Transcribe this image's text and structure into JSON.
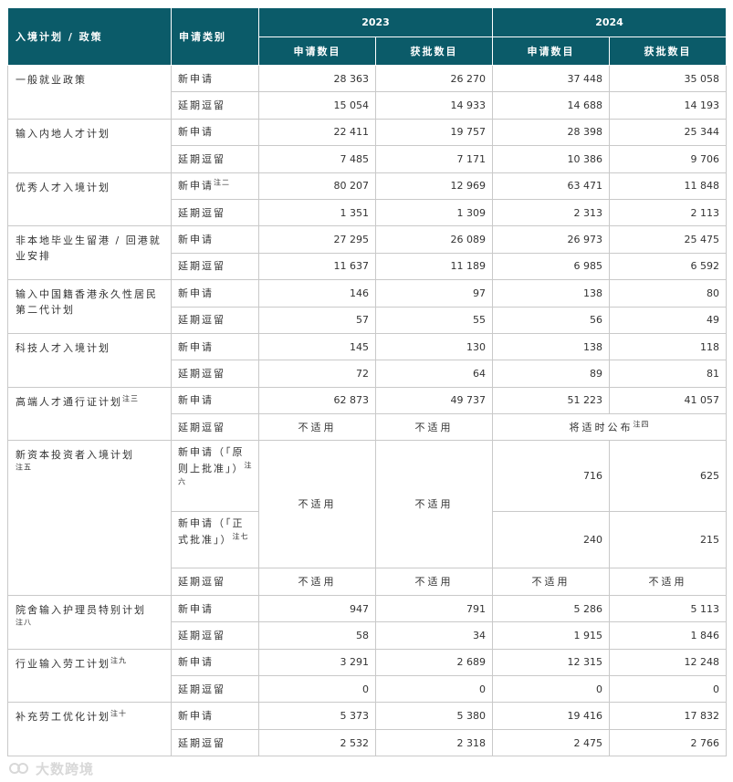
{
  "header": {
    "programme": "入境计划 / 政策",
    "category": "申请类别",
    "year1": "2023",
    "year2": "2024",
    "applications": "申请数目",
    "approved": "获批数目"
  },
  "labels": {
    "new": "新申请",
    "extension": "延期逗留",
    "na": "不适用"
  },
  "rows": {
    "gep": {
      "name": "一般就业政策",
      "new": [
        "28 363",
        "26 270",
        "37 448",
        "35 058"
      ],
      "ext": [
        "15 054",
        "14 933",
        "14 688",
        "14 193"
      ]
    },
    "asmtp": {
      "name": "输入内地人才计划",
      "new": [
        "22 411",
        "19 757",
        "28 398",
        "25 344"
      ],
      "ext": [
        "7 485",
        "7 171",
        "10 386",
        "9 706"
      ]
    },
    "qmas": {
      "name": "优秀人才入境计划",
      "note_new": "注二",
      "new": [
        "80 207",
        "12 969",
        "63 471",
        "11 848"
      ],
      "ext": [
        "1 351",
        "1 309",
        "2 313",
        "2 113"
      ]
    },
    "irnm": {
      "name": "非本地毕业生留港 / 回港就业安排",
      "new": [
        "27 295",
        "26 089",
        "26 973",
        "25 475"
      ],
      "ext": [
        "11 637",
        "11 189",
        "6 985",
        "6 592"
      ]
    },
    "second": {
      "name": "输入中国籍香港永久性居民第二代计划",
      "new": [
        "146",
        "97",
        "138",
        "80"
      ],
      "ext": [
        "57",
        "55",
        "56",
        "49"
      ]
    },
    "techtas": {
      "name": "科技人才入境计划",
      "new": [
        "145",
        "130",
        "138",
        "118"
      ],
      "ext": [
        "72",
        "64",
        "89",
        "81"
      ]
    },
    "ttps": {
      "name": "高端人才通行证计划",
      "note": "注三",
      "new": [
        "62 873",
        "49 737",
        "51 223",
        "41 057"
      ],
      "ext_pending": "将适时公布",
      "note_pending": "注四"
    },
    "ciies": {
      "name": "新资本投资者入境计划",
      "note": "注五",
      "principle_label": "新申请（「原则上批准」）",
      "note_principle": "注六",
      "formal_label": "新申请（「正式批准」）",
      "note_formal": "注七",
      "principle": [
        "716",
        "625"
      ],
      "formal": [
        "240",
        "215"
      ]
    },
    "scheme_care": {
      "name": "院舍输入护理员特别计划",
      "note": "注八",
      "new": [
        "947",
        "791",
        "5 286",
        "5 113"
      ],
      "ext": [
        "58",
        "34",
        "1 915",
        "1 846"
      ]
    },
    "sector": {
      "name": "行业输入劳工计划",
      "note": "注九",
      "new": [
        "3 291",
        "2 689",
        "12 315",
        "12 248"
      ],
      "ext": [
        "0",
        "0",
        "0",
        "0"
      ]
    },
    "slsp": {
      "name": "补充劳工优化计划",
      "note": "注十",
      "new": [
        "5 373",
        "5 380",
        "19 416",
        "17 832"
      ],
      "ext": [
        "2 532",
        "2 318",
        "2 475",
        "2 766"
      ]
    }
  },
  "watermark": "大数跨境",
  "icons": {
    "watermark": "logo-icon"
  }
}
